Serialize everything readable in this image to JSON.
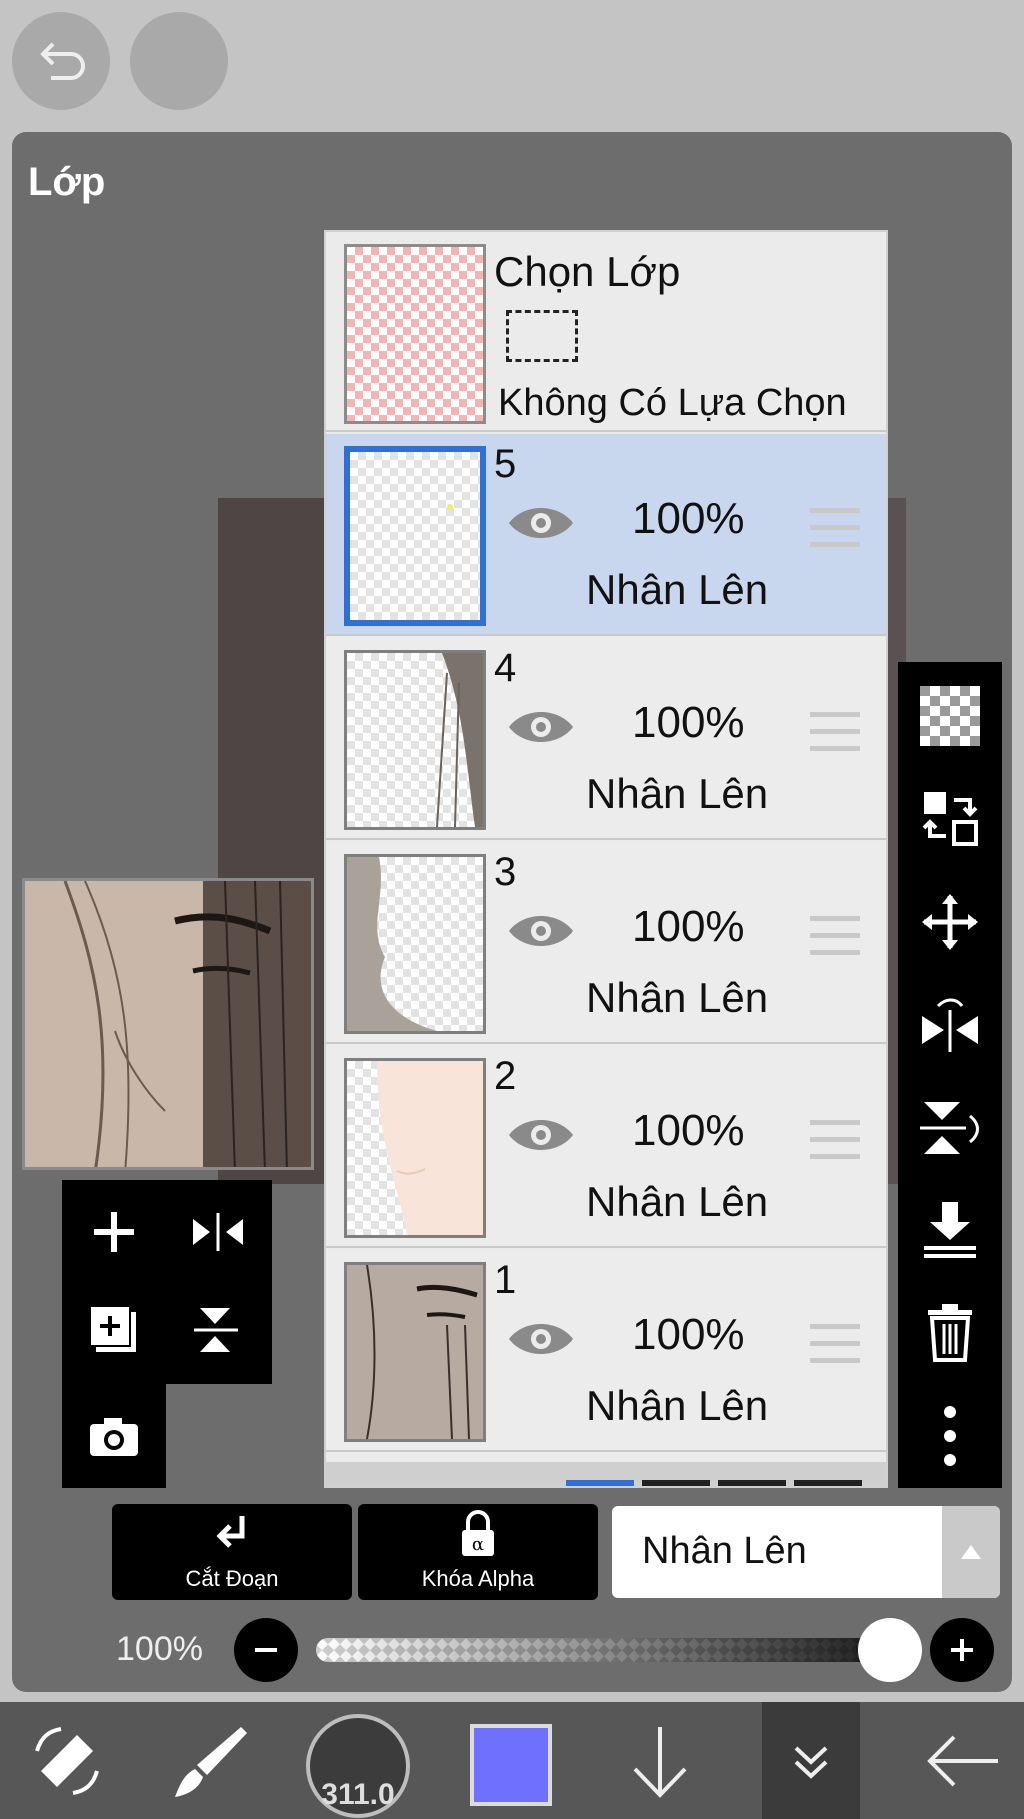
{
  "panel_title": "Lớp",
  "selection_layer": {
    "title": "Chọn Lớp",
    "status": "Không Có Lựa Chọn"
  },
  "layers": [
    {
      "number": "5",
      "opacity": "100%",
      "blend": "Nhân Lên",
      "selected": true
    },
    {
      "number": "4",
      "opacity": "100%",
      "blend": "Nhân Lên",
      "selected": false
    },
    {
      "number": "3",
      "opacity": "100%",
      "blend": "Nhân Lên",
      "selected": false
    },
    {
      "number": "2",
      "opacity": "100%",
      "blend": "Nhân Lên",
      "selected": false
    },
    {
      "number": "1",
      "opacity": "100%",
      "blend": "Nhân Lên",
      "selected": false
    }
  ],
  "clipping_button": {
    "label": "Cắt Đoạn"
  },
  "alpha_lock_button": {
    "label": "Khóa Alpha"
  },
  "blend_mode_select": {
    "value": "Nhân Lên"
  },
  "layer_opacity": {
    "label": "100%",
    "value": 1.0
  },
  "toolbar": {
    "brush_size": "311.0",
    "color": "#7070ff"
  },
  "accent_color": "#2f6fd6",
  "icons": {
    "top": [
      "undo-icon"
    ],
    "left_tools": [
      "add-layer-icon",
      "flip-horizontal-icon",
      "add-layer-copy-icon",
      "flip-vertical-icon",
      "camera-icon"
    ],
    "right_tools": [
      "transparency-icon",
      "swap-layers-icon",
      "move-icon",
      "flip-horizontal-icon",
      "flip-vertical-icon",
      "merge-down-icon",
      "trash-icon",
      "more-icon"
    ],
    "bottom_bar": [
      "transform-icon",
      "brush-icon",
      "arrow-down-icon",
      "double-chevron-down-icon",
      "back-arrow-icon"
    ]
  }
}
